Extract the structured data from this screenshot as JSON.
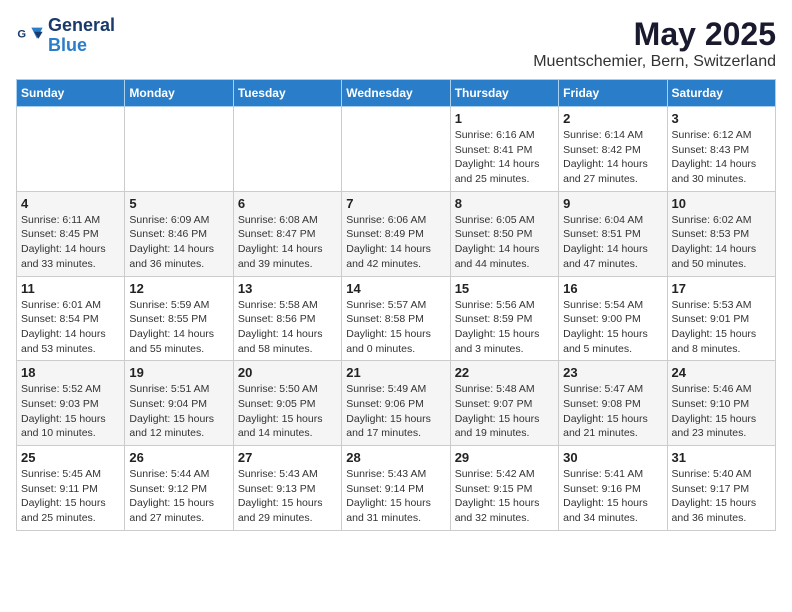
{
  "header": {
    "logo_line1": "General",
    "logo_line2": "Blue",
    "title": "May 2025",
    "subtitle": "Muentschemier, Bern, Switzerland"
  },
  "weekdays": [
    "Sunday",
    "Monday",
    "Tuesday",
    "Wednesday",
    "Thursday",
    "Friday",
    "Saturday"
  ],
  "weeks": [
    [
      {
        "day": "",
        "detail": ""
      },
      {
        "day": "",
        "detail": ""
      },
      {
        "day": "",
        "detail": ""
      },
      {
        "day": "",
        "detail": ""
      },
      {
        "day": "1",
        "detail": "Sunrise: 6:16 AM\nSunset: 8:41 PM\nDaylight: 14 hours\nand 25 minutes."
      },
      {
        "day": "2",
        "detail": "Sunrise: 6:14 AM\nSunset: 8:42 PM\nDaylight: 14 hours\nand 27 minutes."
      },
      {
        "day": "3",
        "detail": "Sunrise: 6:12 AM\nSunset: 8:43 PM\nDaylight: 14 hours\nand 30 minutes."
      }
    ],
    [
      {
        "day": "4",
        "detail": "Sunrise: 6:11 AM\nSunset: 8:45 PM\nDaylight: 14 hours\nand 33 minutes."
      },
      {
        "day": "5",
        "detail": "Sunrise: 6:09 AM\nSunset: 8:46 PM\nDaylight: 14 hours\nand 36 minutes."
      },
      {
        "day": "6",
        "detail": "Sunrise: 6:08 AM\nSunset: 8:47 PM\nDaylight: 14 hours\nand 39 minutes."
      },
      {
        "day": "7",
        "detail": "Sunrise: 6:06 AM\nSunset: 8:49 PM\nDaylight: 14 hours\nand 42 minutes."
      },
      {
        "day": "8",
        "detail": "Sunrise: 6:05 AM\nSunset: 8:50 PM\nDaylight: 14 hours\nand 44 minutes."
      },
      {
        "day": "9",
        "detail": "Sunrise: 6:04 AM\nSunset: 8:51 PM\nDaylight: 14 hours\nand 47 minutes."
      },
      {
        "day": "10",
        "detail": "Sunrise: 6:02 AM\nSunset: 8:53 PM\nDaylight: 14 hours\nand 50 minutes."
      }
    ],
    [
      {
        "day": "11",
        "detail": "Sunrise: 6:01 AM\nSunset: 8:54 PM\nDaylight: 14 hours\nand 53 minutes."
      },
      {
        "day": "12",
        "detail": "Sunrise: 5:59 AM\nSunset: 8:55 PM\nDaylight: 14 hours\nand 55 minutes."
      },
      {
        "day": "13",
        "detail": "Sunrise: 5:58 AM\nSunset: 8:56 PM\nDaylight: 14 hours\nand 58 minutes."
      },
      {
        "day": "14",
        "detail": "Sunrise: 5:57 AM\nSunset: 8:58 PM\nDaylight: 15 hours\nand 0 minutes."
      },
      {
        "day": "15",
        "detail": "Sunrise: 5:56 AM\nSunset: 8:59 PM\nDaylight: 15 hours\nand 3 minutes."
      },
      {
        "day": "16",
        "detail": "Sunrise: 5:54 AM\nSunset: 9:00 PM\nDaylight: 15 hours\nand 5 minutes."
      },
      {
        "day": "17",
        "detail": "Sunrise: 5:53 AM\nSunset: 9:01 PM\nDaylight: 15 hours\nand 8 minutes."
      }
    ],
    [
      {
        "day": "18",
        "detail": "Sunrise: 5:52 AM\nSunset: 9:03 PM\nDaylight: 15 hours\nand 10 minutes."
      },
      {
        "day": "19",
        "detail": "Sunrise: 5:51 AM\nSunset: 9:04 PM\nDaylight: 15 hours\nand 12 minutes."
      },
      {
        "day": "20",
        "detail": "Sunrise: 5:50 AM\nSunset: 9:05 PM\nDaylight: 15 hours\nand 14 minutes."
      },
      {
        "day": "21",
        "detail": "Sunrise: 5:49 AM\nSunset: 9:06 PM\nDaylight: 15 hours\nand 17 minutes."
      },
      {
        "day": "22",
        "detail": "Sunrise: 5:48 AM\nSunset: 9:07 PM\nDaylight: 15 hours\nand 19 minutes."
      },
      {
        "day": "23",
        "detail": "Sunrise: 5:47 AM\nSunset: 9:08 PM\nDaylight: 15 hours\nand 21 minutes."
      },
      {
        "day": "24",
        "detail": "Sunrise: 5:46 AM\nSunset: 9:10 PM\nDaylight: 15 hours\nand 23 minutes."
      }
    ],
    [
      {
        "day": "25",
        "detail": "Sunrise: 5:45 AM\nSunset: 9:11 PM\nDaylight: 15 hours\nand 25 minutes."
      },
      {
        "day": "26",
        "detail": "Sunrise: 5:44 AM\nSunset: 9:12 PM\nDaylight: 15 hours\nand 27 minutes."
      },
      {
        "day": "27",
        "detail": "Sunrise: 5:43 AM\nSunset: 9:13 PM\nDaylight: 15 hours\nand 29 minutes."
      },
      {
        "day": "28",
        "detail": "Sunrise: 5:43 AM\nSunset: 9:14 PM\nDaylight: 15 hours\nand 31 minutes."
      },
      {
        "day": "29",
        "detail": "Sunrise: 5:42 AM\nSunset: 9:15 PM\nDaylight: 15 hours\nand 32 minutes."
      },
      {
        "day": "30",
        "detail": "Sunrise: 5:41 AM\nSunset: 9:16 PM\nDaylight: 15 hours\nand 34 minutes."
      },
      {
        "day": "31",
        "detail": "Sunrise: 5:40 AM\nSunset: 9:17 PM\nDaylight: 15 hours\nand 36 minutes."
      }
    ]
  ]
}
